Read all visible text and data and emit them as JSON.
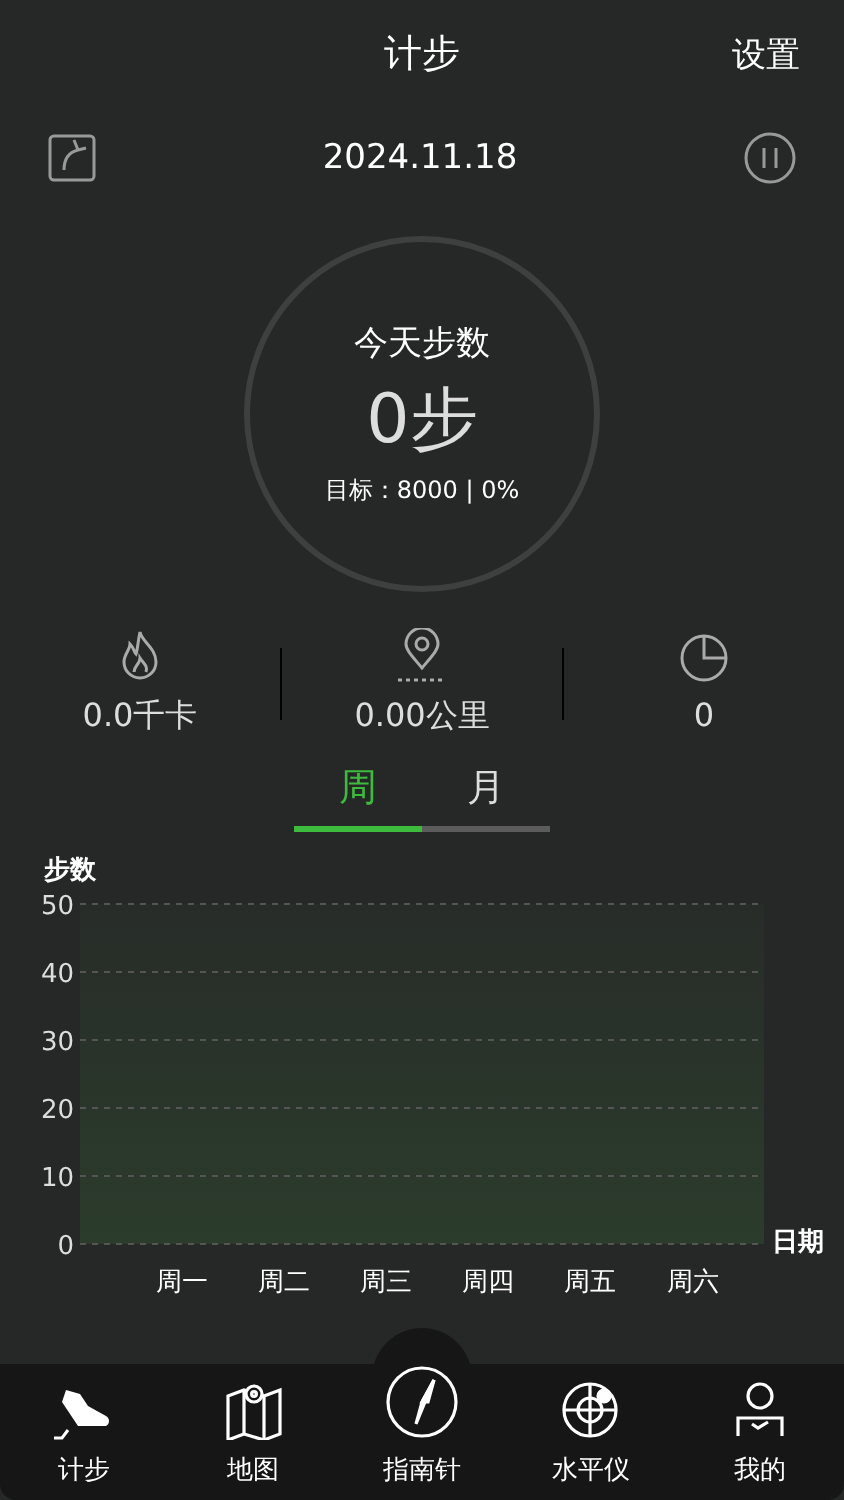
{
  "header": {
    "title": "计步",
    "action": "设置"
  },
  "date_row": {
    "date": "2024.11.18"
  },
  "today": {
    "title": "今天步数",
    "steps": "0步",
    "goal": "目标：8000 | 0%"
  },
  "stats": [
    {
      "kind": "calories",
      "value": "0.0千卡"
    },
    {
      "kind": "distance",
      "value": "0.00公里"
    },
    {
      "kind": "time",
      "value": "0"
    }
  ],
  "period_tabs": [
    {
      "label": "周",
      "selected": true
    },
    {
      "label": "月",
      "selected": false
    }
  ],
  "chart": {
    "chart_data": {
      "type": "area",
      "ylabel": "步数",
      "xlabel": "日期",
      "categories": [
        "周一",
        "周二",
        "周三",
        "周四",
        "周五",
        "周六"
      ],
      "ylim": [
        0,
        50
      ],
      "yticks": [
        0,
        10,
        20,
        30,
        40,
        50
      ],
      "grid": true
    }
  },
  "bottom_nav": [
    {
      "kind": "steps",
      "label": "计步"
    },
    {
      "kind": "map",
      "label": "地图"
    },
    {
      "kind": "compass",
      "label": "指南针"
    },
    {
      "kind": "level",
      "label": "水平仪"
    },
    {
      "kind": "profile",
      "label": "我的"
    }
  ]
}
